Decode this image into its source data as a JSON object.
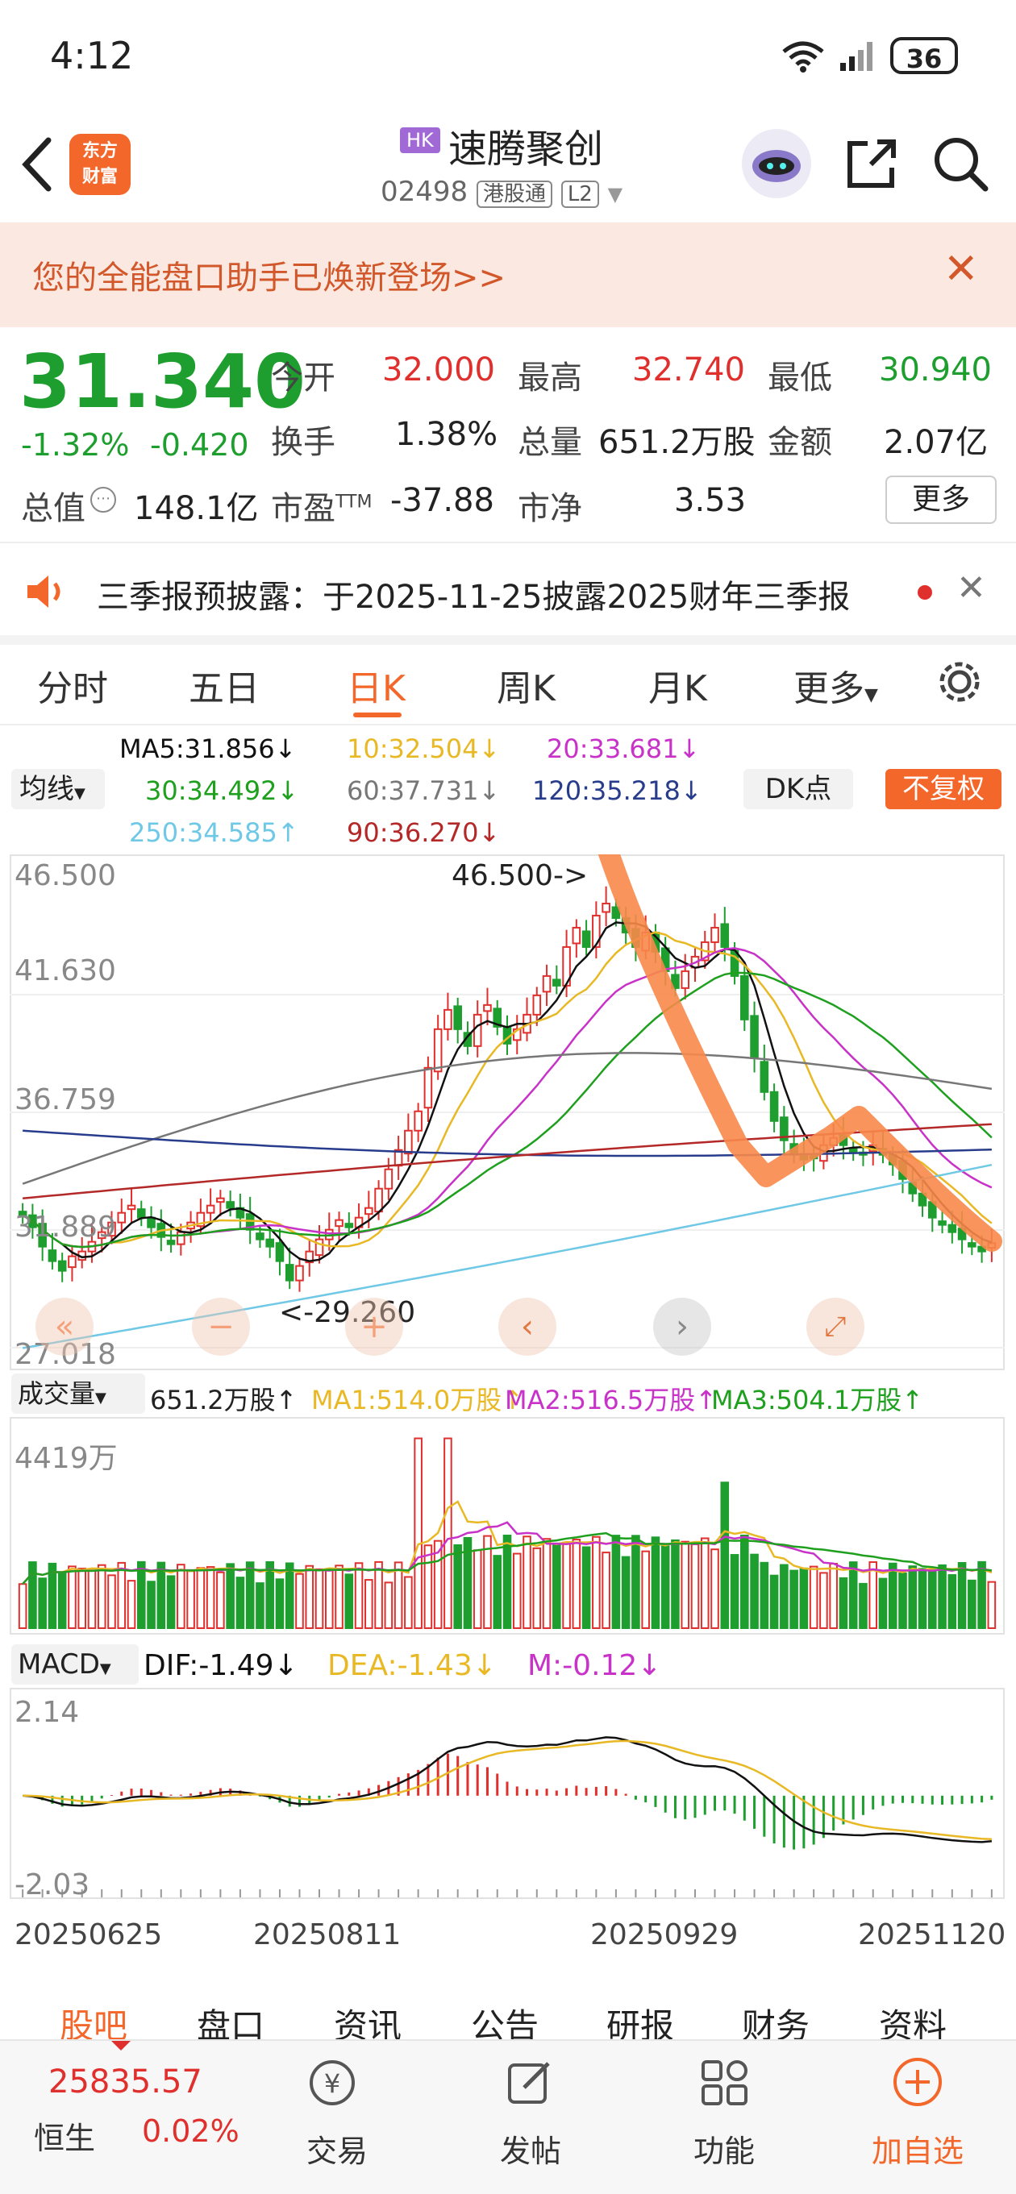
{
  "status": {
    "time": "4:12",
    "battery": "36"
  },
  "header": {
    "logo": "东方\n财富",
    "market_badge": "HK",
    "name": "速腾聚创",
    "code": "02498",
    "tag1": "港股通",
    "tag2": "L2"
  },
  "banner": {
    "text": "您的全能盘口助手已焕新登场>>",
    "close": "✕"
  },
  "quote": {
    "price": "31.340",
    "change_pct": "-1.32%",
    "change": "-0.420",
    "open_label": "今开",
    "open": "32.000",
    "high_label": "最高",
    "high": "32.740",
    "low_label": "最低",
    "low": "30.940",
    "turnover_label": "换手",
    "turnover": "1.38%",
    "volume_label": "总量",
    "volume": "651.2万股",
    "amount_label": "金额",
    "amount": "2.07亿",
    "mcap_label": "总值",
    "mcap": "148.1亿",
    "pe_label": "市盈",
    "pe_sup": "TTM",
    "pe": "-37.88",
    "pb_label": "市净",
    "pb": "3.53",
    "more_button": "更多"
  },
  "notice": {
    "text": "三季报预披露：于2025-11-25披露2025财年三季报",
    "close": "✕"
  },
  "ktabs": [
    "分时",
    "五日",
    "日K",
    "周K",
    "月K",
    "更多"
  ],
  "active_tab": 2,
  "ma_legend": {
    "selector": "均线",
    "ma5": "MA5:31.856↓",
    "ma10": "10:32.504↓",
    "ma20": "20:33.681↓",
    "ma30": "30:34.492↓",
    "ma60": "60:37.731↓",
    "ma120": "120:35.218↓",
    "ma250": "250:34.585↑",
    "ma90": "90:36.270↓",
    "dk_button": "DK点",
    "adjust_button": "不复权"
  },
  "colors": {
    "up": "#e0302d",
    "down": "#1e9e2e",
    "ma5": "#111111",
    "ma10": "#e8b825",
    "ma20": "#c832c8",
    "ma30": "#1ea01e",
    "ma60": "#777777",
    "ma120": "#283c8c",
    "ma250": "#6ec8e6",
    "ma90": "#b42828",
    "accent": "#f4672b"
  },
  "chart_data": [
    {
      "type": "candlestick",
      "y_ticks": [
        "46.500",
        "41.630",
        "36.759",
        "31.889",
        "27.018"
      ],
      "ylim": [
        27.018,
        46.5
      ],
      "x_labels": [
        "20250625",
        "20250811",
        "20250929",
        "20251120"
      ],
      "annotations": [
        "46.500->",
        "<-29.260"
      ],
      "closes": [
        32.5,
        32.0,
        31.2,
        30.6,
        30.2,
        30.8,
        31.0,
        31.4,
        31.8,
        32.2,
        32.6,
        32.9,
        32.4,
        32.0,
        31.6,
        31.3,
        31.8,
        32.2,
        32.6,
        32.9,
        33.2,
        32.8,
        32.4,
        31.9,
        31.5,
        31.2,
        30.6,
        29.8,
        30.4,
        31.0,
        31.5,
        31.9,
        32.3,
        32.0,
        32.4,
        32.8,
        33.6,
        34.4,
        35.2,
        36.0,
        36.8,
        38.6,
        40.2,
        41.0,
        40.2,
        39.5,
        40.8,
        41.2,
        40.3,
        39.6,
        40.2,
        40.8,
        41.6,
        42.4,
        42.0,
        43.6,
        44.4,
        43.6,
        44.9,
        45.4,
        44.8,
        44.2,
        43.6,
        44.2,
        43.4,
        42.6,
        41.9,
        42.6,
        43.2,
        43.8,
        44.4,
        43.6,
        42.4,
        40.6,
        39.0,
        37.6,
        36.4,
        35.6,
        35.0,
        34.8,
        34.9,
        35.4,
        35.7,
        35.4,
        35.1,
        35.0,
        35.4,
        35.0,
        34.6,
        34.0,
        33.4,
        32.9,
        32.4,
        32.1,
        31.8,
        31.5,
        31.2,
        31.0,
        31.34
      ],
      "ma5_last": 31.856,
      "ma10_last": 32.504,
      "ma20_last": 33.681,
      "ma30_last": 34.492,
      "ma60_last": 37.731,
      "ma120_last": 35.218,
      "ma250_last": 34.585,
      "ma90_last": 36.27
    },
    {
      "type": "bar",
      "title": "成交量",
      "legend": [
        "651.2万股↑",
        "MA1:514.0万股↑",
        "MA2:516.5万股↑",
        "MA3:504.1万股↑"
      ],
      "y_ticks": [
        "4419万"
      ],
      "ylim": [
        0,
        4419
      ]
    },
    {
      "type": "bar",
      "title": "MACD",
      "legend": [
        "DIF:-1.49↓",
        "DEA:-1.43↓",
        "M:-0.12↓"
      ],
      "y_ticks": [
        "2.14",
        "-2.03"
      ],
      "ylim": [
        -2.03,
        2.14
      ]
    }
  ],
  "vol_legend": {
    "selector": "成交量",
    "v": "651.2万股↑",
    "ma1": "MA1:514.0万股↑",
    "ma2": "MA2:516.5万股↑",
    "ma3": "MA3:504.1万股↑",
    "tick": "4419万"
  },
  "macd_legend": {
    "selector": "MACD",
    "dif": "DIF:-1.49↓",
    "dea": "DEA:-1.43↓",
    "m": "M:-0.12↓",
    "tick_top": "2.14",
    "tick_bottom": "-2.03"
  },
  "dates": [
    "20250625",
    "20250811",
    "20250929",
    "20251120"
  ],
  "subtabs": [
    "股吧",
    "盘口",
    "资讯",
    "公告",
    "研报",
    "财务",
    "资料"
  ],
  "bottom": {
    "index_value": "25835.57",
    "index_name": "恒生",
    "index_change": "0.02%",
    "trade": "交易",
    "post": "发帖",
    "func": "功能",
    "add": "加自选"
  }
}
